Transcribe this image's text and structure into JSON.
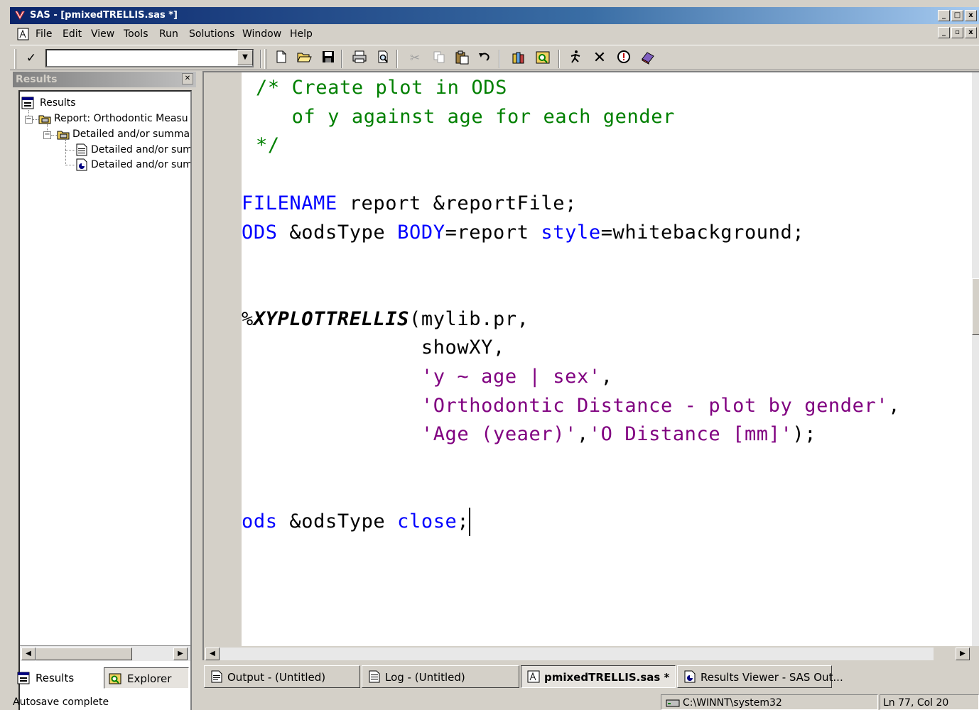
{
  "window": {
    "title": "SAS - [pmixedTRELLIS.sas *]"
  },
  "menu": {
    "items": [
      "File",
      "Edit",
      "View",
      "Tools",
      "Run",
      "Solutions",
      "Window",
      "Help"
    ]
  },
  "toolbar": {
    "command_value": "",
    "icons": [
      "checkmark-icon",
      "dropdown-arrow-icon",
      "new-icon",
      "open-icon",
      "save-icon",
      "print-icon",
      "print-preview-icon",
      "cut-icon",
      "copy-icon",
      "paste-icon",
      "undo-icon",
      "libraries-icon",
      "explorer-icon",
      "submit-icon",
      "clear-icon",
      "help-icon",
      "ods-icon"
    ]
  },
  "results_panel": {
    "title": "Results",
    "tree": [
      {
        "label": "Results",
        "depth": 0,
        "icon": "results-icon"
      },
      {
        "label": "Report:  Orthodontic Measu",
        "depth": 1,
        "icon": "folder-printer-icon"
      },
      {
        "label": "Detailed and/or summari",
        "depth": 2,
        "icon": "folder-printer-icon"
      },
      {
        "label": "Detailed and/or sum",
        "depth": 3,
        "icon": "table-doc-icon"
      },
      {
        "label": "Detailed and/or sum",
        "depth": 3,
        "icon": "graph-doc-icon"
      }
    ],
    "tabs": [
      "Results",
      "Explorer"
    ]
  },
  "editor": {
    "lines": [
      [
        {
          "t": "/* Create plot in ODS",
          "c": "cm"
        }
      ],
      [
        {
          "t": "   of y against age for each gender",
          "c": "cm"
        }
      ],
      [
        {
          "t": "*/",
          "c": "cm"
        }
      ],
      [],
      [
        {
          "t": "FILENAME",
          "c": "kw"
        },
        {
          "t": " report &reportFile;",
          "c": "tx"
        }
      ],
      [
        {
          "t": "ODS",
          "c": "kw"
        },
        {
          "t": " &odsType ",
          "c": "tx"
        },
        {
          "t": "BODY",
          "c": "kw"
        },
        {
          "t": "=report ",
          "c": "tx"
        },
        {
          "t": "style",
          "c": "kw"
        },
        {
          "t": "=whitebackground;",
          "c": "tx"
        }
      ],
      [],
      [],
      [
        {
          "t": "%",
          "c": "tx"
        },
        {
          "t": "XYPLOTTRELLIS",
          "c": "mc"
        },
        {
          "t": "(mylib.pr,",
          "c": "tx"
        }
      ],
      [
        {
          "t": "               showXY,",
          "c": "tx"
        }
      ],
      [
        {
          "t": "               ",
          "c": "tx"
        },
        {
          "t": "'y ~ age | sex'",
          "c": "st"
        },
        {
          "t": ",",
          "c": "tx"
        }
      ],
      [
        {
          "t": "               ",
          "c": "tx"
        },
        {
          "t": "'Orthodontic Distance - plot by gender'",
          "c": "st"
        },
        {
          "t": ",",
          "c": "tx"
        }
      ],
      [
        {
          "t": "               ",
          "c": "tx"
        },
        {
          "t": "'Age (yeaer)'",
          "c": "st"
        },
        {
          "t": ",",
          "c": "tx"
        },
        {
          "t": "'O Distance [mm]'",
          "c": "st"
        },
        {
          "t": ");",
          "c": "tx"
        }
      ],
      [],
      [],
      [
        {
          "t": "ods",
          "c": "kw"
        },
        {
          "t": " &odsType ",
          "c": "tx"
        },
        {
          "t": "close",
          "c": "kw"
        },
        {
          "t": ";",
          "c": "tx"
        }
      ]
    ],
    "colors": {
      "comment": "#008000",
      "keyword": "#0000ff",
      "string": "#800080",
      "text": "#000000"
    }
  },
  "window_tabs": [
    {
      "label": "Output - (Untitled)",
      "icon": "output-icon",
      "active": false
    },
    {
      "label": "Log - (Untitled)",
      "icon": "log-icon",
      "active": false
    },
    {
      "label": "pmixedTRELLIS.sas *",
      "icon": "editor-icon",
      "active": true
    },
    {
      "label": "Results Viewer - SAS Out...",
      "icon": "results-viewer-icon",
      "active": false
    }
  ],
  "status": {
    "message": "Autosave complete",
    "path": "C:\\WINNT\\system32",
    "position": "Ln 77, Col 20"
  }
}
